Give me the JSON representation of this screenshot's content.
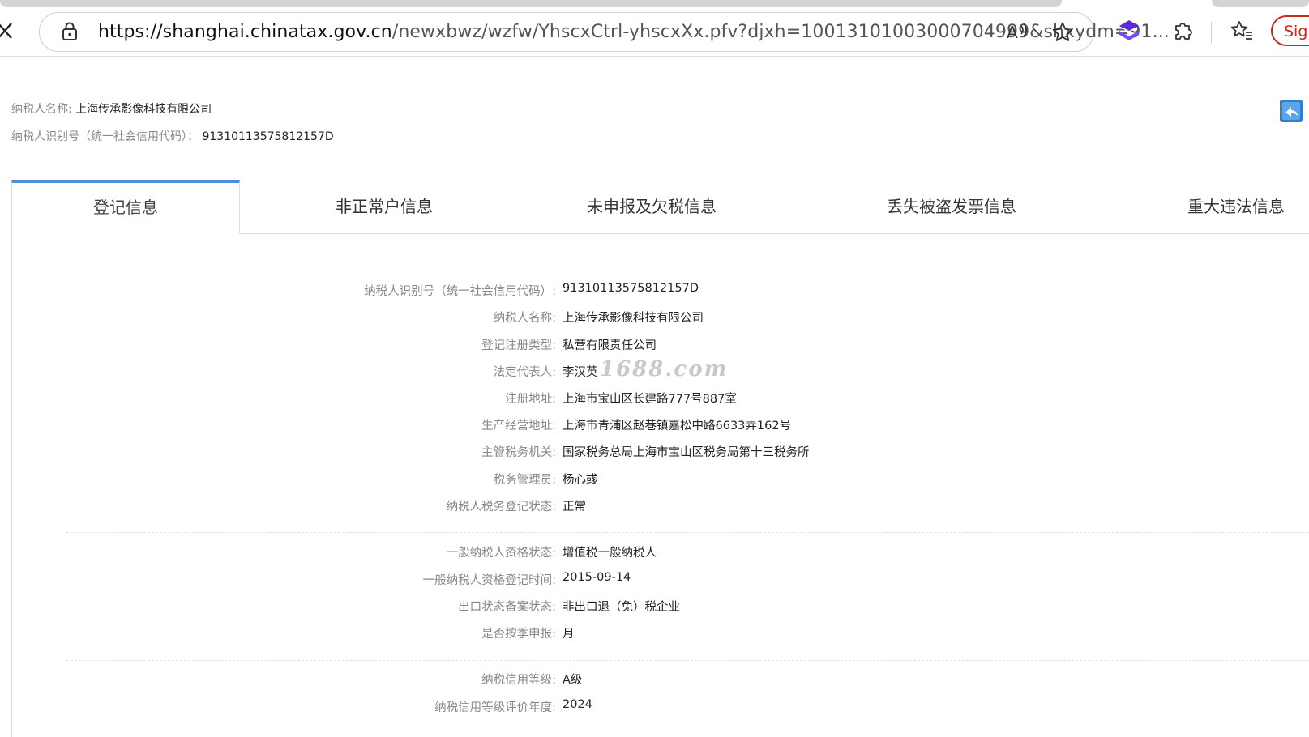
{
  "browser": {
    "url_host": "https://shanghai.chinatax.gov.cn",
    "url_path": "/newxbwz/wzfw/YhscxCtrl-yhscxXx.pfv?djxh=10013101003000704999&shxydm=91...",
    "sign_in_label": "Sign"
  },
  "header": {
    "name_label": "纳税人名称:",
    "name_value": "上海传承影像科技有限公司",
    "id_label": "纳税人识别号（统一社会信用代码）：",
    "id_value": "91310113575812157D"
  },
  "tabs": [
    {
      "label": "登记信息",
      "active": true
    },
    {
      "label": "非正常户信息"
    },
    {
      "label": "未申报及欠税信息"
    },
    {
      "label": "丢失被盗发票信息"
    },
    {
      "label": "重大违法信息"
    }
  ],
  "section1": [
    {
      "label": "纳税人识别号（统一社会信用代码）:",
      "value": "91310113575812157D"
    },
    {
      "label": "纳税人名称:",
      "value": "上海传承影像科技有限公司"
    },
    {
      "label": "登记注册类型:",
      "value": "私营有限责任公司"
    },
    {
      "label": "法定代表人:",
      "value": "李汉英"
    },
    {
      "label": "注册地址:",
      "value": "上海市宝山区长建路777号887室"
    },
    {
      "label": "生产经营地址:",
      "value": "上海市青浦区赵巷镇嘉松中路6633弄162号"
    },
    {
      "label": "主管税务机关:",
      "value": "国家税务总局上海市宝山区税务局第十三税务所"
    },
    {
      "label": "税务管理员:",
      "value": "杨心彧"
    },
    {
      "label": "纳税人税务登记状态:",
      "value": "正常"
    }
  ],
  "section2": [
    {
      "label": "一般纳税人资格状态:",
      "value": "增值税一般纳税人"
    },
    {
      "label": "一般纳税人资格登记时间:",
      "value": "2015-09-14"
    },
    {
      "label": "出口状态备案状态:",
      "value": "非出口退（免）税企业"
    },
    {
      "label": "是否按季申报:",
      "value": "月"
    }
  ],
  "section3": [
    {
      "label": "纳税信用等级:",
      "value": "A级"
    },
    {
      "label": "纳税信用等级评价年度:",
      "value": "2024"
    }
  ],
  "watermark": "1688.com",
  "colors": {
    "accent": "#4a90d9",
    "sign": "#c42b1c",
    "edge_purple": "#5b2bd6"
  }
}
